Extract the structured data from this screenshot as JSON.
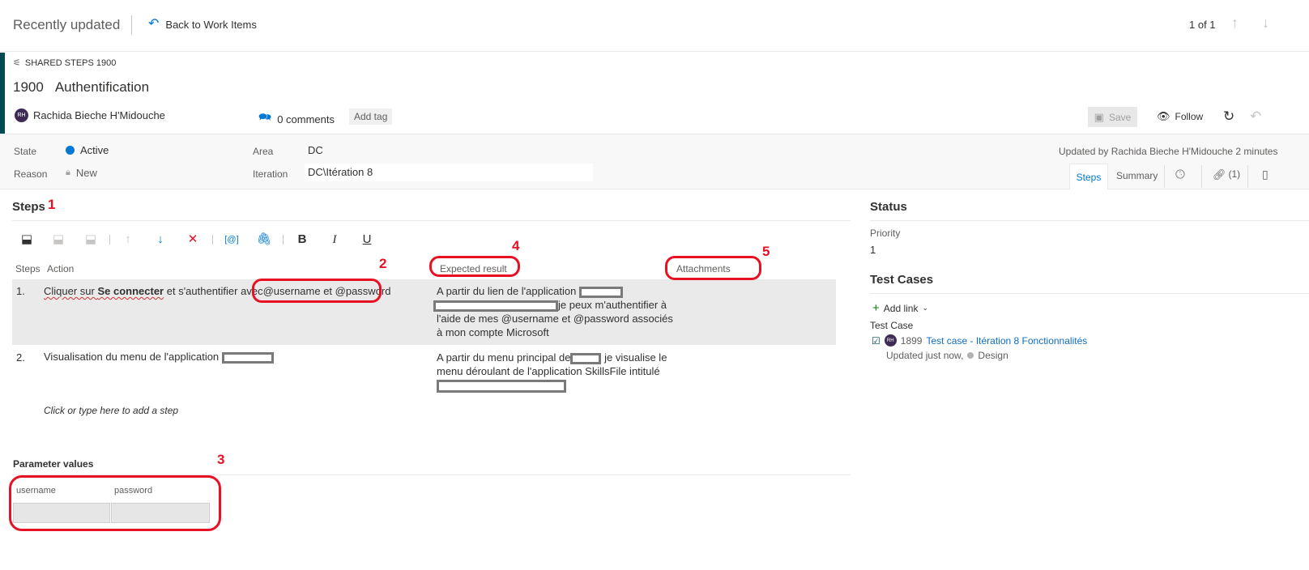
{
  "topbar": {
    "recently_updated": "Recently updated",
    "back_label": "Back to Work Items",
    "pager": "1 of 1"
  },
  "workitem": {
    "type_label": "SHARED STEPS 1900",
    "id": "1900",
    "title": "Authentification",
    "assignee_initials": "RH",
    "assignee": "Rachida Bieche H'Midouche",
    "comments": "0 comments",
    "add_tag": "Add tag",
    "save": "Save",
    "follow": "Follow"
  },
  "fields": {
    "state_label": "State",
    "state_value": "Active",
    "reason_label": "Reason",
    "reason_value": "New",
    "area_label": "Area",
    "area_value": "DC",
    "iteration_label": "Iteration",
    "iteration_value": "DC\\Itération 8",
    "updated_by": "Updated by Rachida Bieche H'Midouche 2 minutes"
  },
  "tabs": {
    "steps": "Steps",
    "summary": "Summary",
    "links": "(1)"
  },
  "steps": {
    "title": "Steps",
    "col_steps": "Steps",
    "col_action": "Action",
    "col_expected": "Expected result",
    "col_attachments": "Attachments",
    "rows": [
      {
        "num": "1.",
        "action_pre": "Cliquer sur ",
        "action_bold": "Se connecter",
        "action_mid": " et s'authentifier avec",
        "action_params": "@username et @password",
        "expected_1": "A partir du lien de l'application",
        "expected_2": "je peux m'authentifier à",
        "expected_3": "l'aide de mes  @username et @password associés",
        "expected_4": "à mon compte Microsoft"
      },
      {
        "num": "2.",
        "action": "Visualisation du menu de l'application",
        "expected_1": "A partir du menu principal de",
        "expected_1b": "je visualise le",
        "expected_2": "menu déroulant de l'application SkillsFile intitulé"
      }
    ],
    "add_step": "Click or type here to add a step"
  },
  "params": {
    "title": "Parameter values",
    "col_username": "username",
    "col_password": "password"
  },
  "status": {
    "title": "Status",
    "priority_label": "Priority",
    "priority_value": "1"
  },
  "testcases": {
    "title": "Test Cases",
    "add_link": "Add link",
    "group_label": "Test Case",
    "item_initials": "RH",
    "item_id": "1899",
    "item_title": "Test case - Itération 8 Fonctionnalités",
    "item_updated": "Updated just now,",
    "item_state": "Design"
  },
  "annotations": {
    "a1": "1",
    "a2": "2",
    "a3": "3",
    "a4": "4",
    "a5": "5"
  },
  "colors": {
    "accent": "#0078d4",
    "type_bar": "#004b50",
    "annotation": "#e81123",
    "row_bg": "#eaeaea",
    "fields_bg": "#f8f8f8"
  }
}
